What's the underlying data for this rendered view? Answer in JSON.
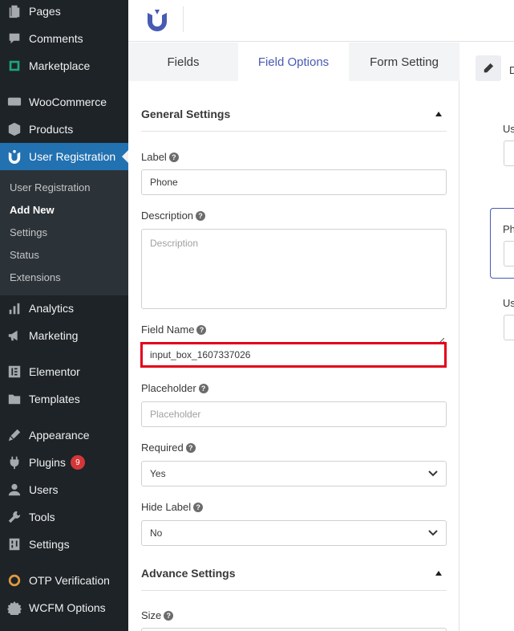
{
  "sidebar": {
    "menu": [
      {
        "label": "Pages",
        "icon": "pages-icon"
      },
      {
        "label": "Comments",
        "icon": "comments-icon"
      },
      {
        "label": "Marketplace",
        "icon": "marketplace-icon"
      },
      {
        "label": "WooCommerce",
        "icon": "woocommerce-icon"
      },
      {
        "label": "Products",
        "icon": "products-icon"
      },
      {
        "label": "User Registration",
        "icon": "user-registration-icon"
      },
      {
        "label": "Analytics",
        "icon": "analytics-icon"
      },
      {
        "label": "Marketing",
        "icon": "marketing-icon"
      },
      {
        "label": "Elementor",
        "icon": "elementor-icon"
      },
      {
        "label": "Templates",
        "icon": "templates-icon"
      },
      {
        "label": "Appearance",
        "icon": "appearance-icon"
      },
      {
        "label": "Plugins",
        "icon": "plugins-icon",
        "badge": "9"
      },
      {
        "label": "Users",
        "icon": "users-icon"
      },
      {
        "label": "Tools",
        "icon": "tools-icon"
      },
      {
        "label": "Settings",
        "icon": "settings-icon"
      },
      {
        "label": "OTP Verification",
        "icon": "otp-icon"
      },
      {
        "label": "WCFM Options",
        "icon": "wcfm-icon"
      }
    ],
    "submenu": [
      "User Registration",
      "Add New",
      "Settings",
      "Status",
      "Extensions"
    ]
  },
  "tabs": [
    "Fields",
    "Field Options",
    "Form Setting"
  ],
  "general_settings": {
    "title": "General Settings",
    "label_label": "Label",
    "label_value": "Phone",
    "description_label": "Description",
    "description_placeholder": "Description",
    "field_name_label": "Field Name",
    "field_name_value": "input_box_1607337026",
    "placeholder_label": "Placeholder",
    "placeholder_placeholder": "Placeholder",
    "required_label": "Required",
    "required_value": "Yes",
    "hide_label_label": "Hide Label",
    "hide_label_value": "No"
  },
  "advance_settings": {
    "title": "Advance Settings",
    "size_label": "Size"
  },
  "preview": {
    "toolbar_letter": "D",
    "label_1": "Us",
    "card_label": "Ph",
    "label_2": "Us"
  },
  "help_glyph": "?",
  "colors": {
    "sidebar_bg": "#1d2327",
    "active_menu": "#2271b1",
    "accent": "#475bb2",
    "highlight": "#e3001b",
    "badge": "#d63638"
  }
}
